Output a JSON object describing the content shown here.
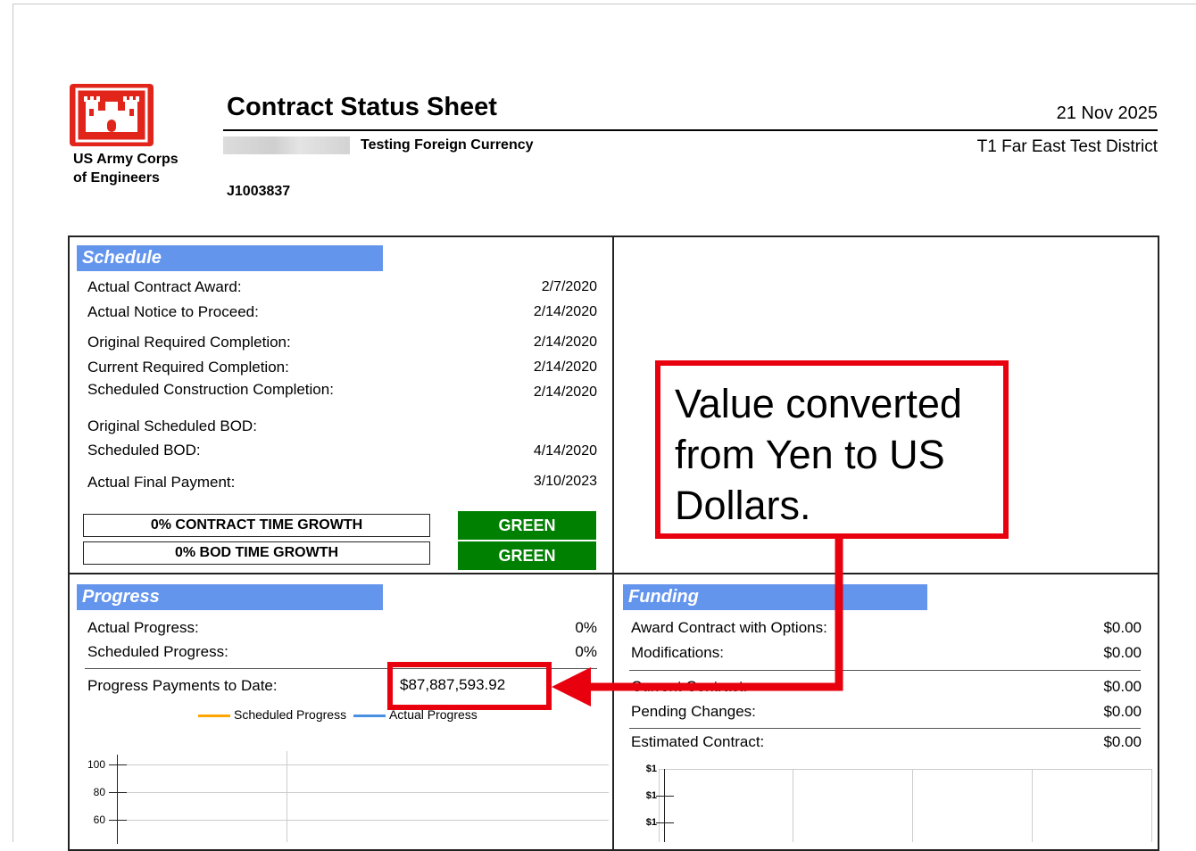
{
  "header": {
    "org_line1": "US Army Corps",
    "org_line2": "of Engineers",
    "title": "Contract Status Sheet",
    "date": "21 Nov 2025",
    "project": "Testing Foreign Currency",
    "district": "T1 Far East Test District",
    "contract_number": "J1003837"
  },
  "schedule": {
    "heading": "Schedule",
    "rows": [
      {
        "label": "Actual Contract Award:",
        "value": "2/7/2020"
      },
      {
        "label": "Actual Notice to Proceed:",
        "value": "2/14/2020"
      },
      {
        "label": "Original Required Completion:",
        "value": "2/14/2020"
      },
      {
        "label": "Current Required Completion:",
        "value": "2/14/2020"
      },
      {
        "label": "Scheduled Construction Completion:",
        "value": "2/14/2020"
      },
      {
        "label": "Original Scheduled BOD:",
        "value": ""
      },
      {
        "label": "Scheduled BOD:",
        "value": "4/14/2020"
      },
      {
        "label": "Actual Final Payment:",
        "value": "3/10/2023"
      }
    ],
    "growth": [
      {
        "label": "0% CONTRACT TIME GROWTH",
        "status": "GREEN"
      },
      {
        "label": "0% BOD TIME GROWTH",
        "status": "GREEN"
      }
    ]
  },
  "progress": {
    "heading": "Progress",
    "actual_label": "Actual Progress:",
    "actual_value": "0%",
    "scheduled_label": "Scheduled Progress:",
    "scheduled_value": "0%",
    "payments_label": "Progress Payments to Date:",
    "payments_value": "$87,887,593.92",
    "legend_scheduled": "Scheduled Progress",
    "legend_actual": "Actual Progress",
    "y_ticks": [
      "100",
      "80",
      "60"
    ]
  },
  "funding": {
    "heading": "Funding",
    "rows": [
      {
        "label": "Award Contract with Options:",
        "value": "$0.00"
      },
      {
        "label": "Modifications:",
        "value": "$0.00"
      },
      {
        "label": "Current Contract:",
        "value": "$0.00"
      },
      {
        "label": "Pending Changes:",
        "value": "$0.00"
      },
      {
        "label": "Estimated Contract:",
        "value": "$0.00"
      }
    ],
    "y_ticks": [
      "$1",
      "$1",
      "$1"
    ]
  },
  "annotation": {
    "callout_text": "Value converted from Yen to US Dollars."
  },
  "colors": {
    "section_header": "#6495ed",
    "status_green": "#008000",
    "logo_red": "#e1251b",
    "callout_red": "#e8000e",
    "legend_scheduled": "#ffa500",
    "legend_actual": "#4a90e2"
  }
}
